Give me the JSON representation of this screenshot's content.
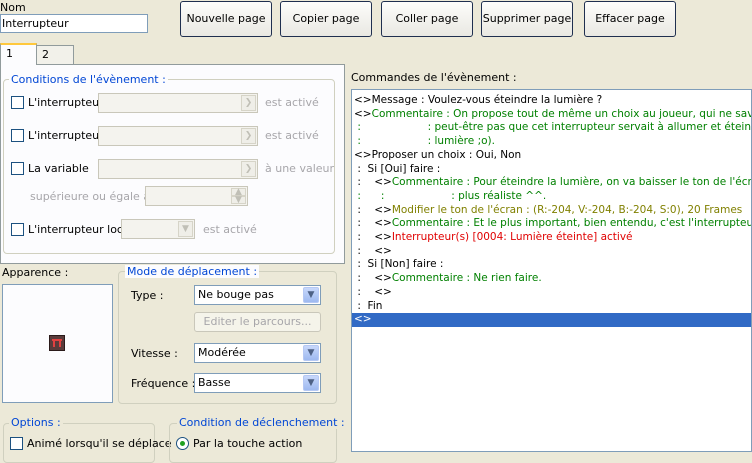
{
  "colors": {
    "legend": "#0046d5",
    "comment": "#008000",
    "tone": "#808000",
    "switch": "#e00000",
    "selection": "#316ac5"
  },
  "header": {
    "name_label": "Nom",
    "name_value": "Interrupteur"
  },
  "toolbar": {
    "new_page": "Nouvelle page",
    "copy_page": "Copier page",
    "paste_page": "Coller page",
    "delete_page": "Supprimer page",
    "clear_page": "Effacer page"
  },
  "tabs": [
    {
      "label": "1"
    },
    {
      "label": "2"
    }
  ],
  "conditions": {
    "legend": "Conditions de l'évènement :",
    "switch1_label": "L'interrupteur",
    "switch1_suffix": "est activé",
    "switch2_label": "L'interrupteur",
    "switch2_suffix": "est activé",
    "variable_label": "La variable",
    "variable_suffix": "à une valeur",
    "variable_compare": "supérieure ou égale à",
    "local_label": "L'interrupteur local",
    "local_suffix": "est activé"
  },
  "appearance": {
    "label": "Apparence :"
  },
  "movement": {
    "legend": "Mode de déplacement :",
    "type_label": "Type :",
    "type_value": "Ne bouge pas",
    "edit_route": "Editer le parcours...",
    "speed_label": "Vitesse :",
    "speed_value": "Modérée",
    "freq_label": "Fréquence :",
    "freq_value": "Basse"
  },
  "options": {
    "legend": "Options :",
    "walk_anim": "Animé lorsqu'il se déplace"
  },
  "trigger": {
    "legend": "Condition de déclenchement :",
    "action_button": "Par la touche action"
  },
  "commands": {
    "label": "Commandes de l'évènement :",
    "lines": [
      {
        "parts": [
          {
            "text": "<>Message : Voulez-vous éteindre la lumière ?",
            "color": "n"
          }
        ]
      },
      {
        "parts": [
          {
            "text": "<>",
            "color": "n"
          },
          {
            "text": "Commentaire : On propose tout de même un choix au joueur, qui ne savait",
            "color": "g"
          }
        ]
      },
      {
        "parts": [
          {
            "text": " :                    : peut-être pas que cet interrupteur servait à allumer et éteindre la",
            "color": "g"
          }
        ]
      },
      {
        "parts": [
          {
            "text": " :                    : lumière ;o).",
            "color": "g"
          }
        ]
      },
      {
        "parts": [
          {
            "text": "<>Proposer un choix : Oui, Non",
            "color": "n"
          }
        ]
      },
      {
        "parts": [
          {
            "text": " :  Si [Oui] faire :",
            "color": "n"
          }
        ]
      },
      {
        "parts": [
          {
            "text": " :    <>",
            "color": "n"
          },
          {
            "text": "Commentaire : Pour éteindre la lumière, on va baisser le ton de l'écran pour faire",
            "color": "g"
          }
        ]
      },
      {
        "parts": [
          {
            "text": " :      :                    : plus réaliste ^^.",
            "color": "g"
          }
        ]
      },
      {
        "parts": [
          {
            "text": " :    <>",
            "color": "n"
          },
          {
            "text": "Modifier le ton de l'écran : (R:-204, V:-204, B:-204, S:0), 20 Frames",
            "color": "o"
          }
        ]
      },
      {
        "parts": [
          {
            "text": " :    <>",
            "color": "n"
          },
          {
            "text": "Commentaire : Et le plus important, bien entendu, c'est l'interrupteur !",
            "color": "g"
          }
        ]
      },
      {
        "parts": [
          {
            "text": " :    <>",
            "color": "n"
          },
          {
            "text": "Interrupteur(s) [0004: Lumière éteinte] activé",
            "color": "r"
          }
        ]
      },
      {
        "parts": [
          {
            "text": " :    <>",
            "color": "n"
          }
        ]
      },
      {
        "parts": [
          {
            "text": " :  Si [Non] faire :",
            "color": "n"
          }
        ]
      },
      {
        "parts": [
          {
            "text": " :    <>",
            "color": "n"
          },
          {
            "text": "Commentaire : Ne rien faire.",
            "color": "g"
          }
        ]
      },
      {
        "parts": [
          {
            "text": " :    <>",
            "color": "n"
          }
        ]
      },
      {
        "parts": [
          {
            "text": " :  Fin",
            "color": "n"
          }
        ]
      },
      {
        "parts": [
          {
            "text": "<>",
            "color": "n"
          }
        ],
        "selected": true
      }
    ]
  }
}
